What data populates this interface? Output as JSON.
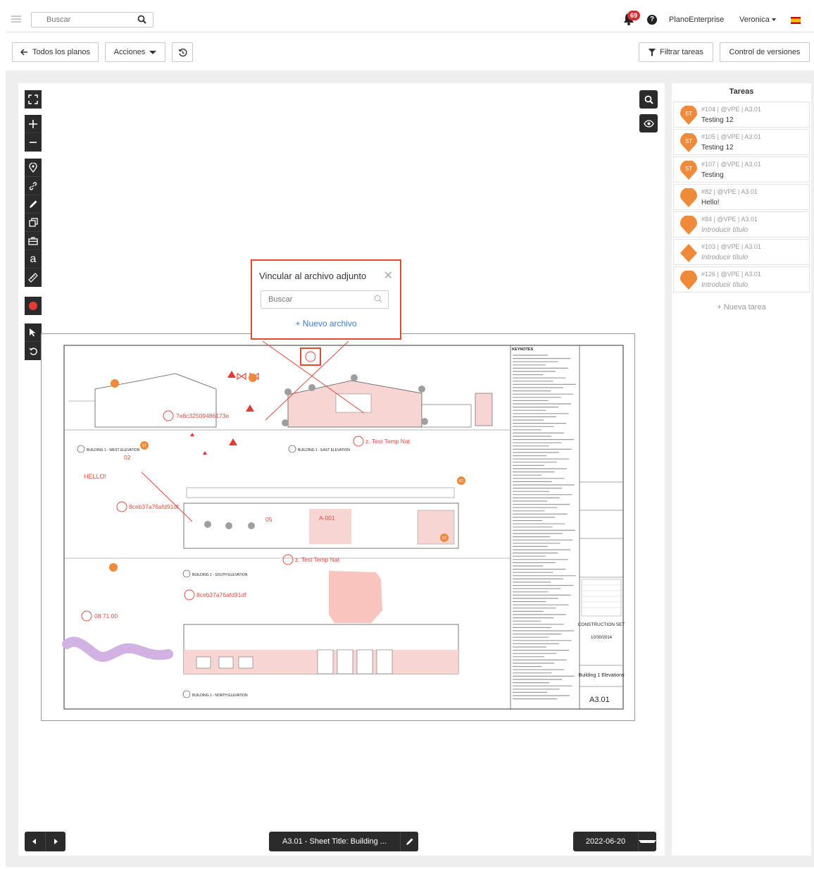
{
  "topbar": {
    "search_placeholder": "Buscar",
    "notification_count": "69",
    "company": "PlanoEnterprise",
    "user": "Veronica"
  },
  "toolbar": {
    "all_plans": "Todos los planos",
    "actions": "Acciones",
    "filter_tasks": "Filtrar tareas",
    "version_control": "Control de versiones"
  },
  "popup": {
    "title": "Vincular al archivo adjunto",
    "search_placeholder": "Buscar",
    "new_file": "+ Nuevo archivo"
  },
  "drawing": {
    "annotations": [
      "7e8c32509486173e",
      "z. Test Temp Nat",
      "HELLO!",
      "8ceb37a76afd91df",
      "02",
      "05",
      "A-001",
      "z. Test Temp Nat",
      "8ceb37a76afd91df",
      "08 71 00"
    ],
    "pin_label": "ST",
    "elevation_titles": [
      "BUILDING 1 - WEST ELEVATION",
      "BUILDING 1 - EAST ELEVATION",
      "BUILDING 1 - SOUTH ELEVATION",
      "BUILDING 1 - NORTH ELEVATION"
    ],
    "keynotes_title": "KEYNOTES",
    "title_block": {
      "status": "CONSTRUCTION SET",
      "date": "10/30/2014",
      "sheet_name": "Building 1 Elevations",
      "sheet_number": "A3.01"
    }
  },
  "bottom": {
    "sheet_label": "A3.01 - Sheet Title: Building ...",
    "date": "2022-06-20"
  },
  "sidebar": {
    "title": "Tareas",
    "tasks": [
      {
        "meta": "#104 | @VPE | A3.01",
        "title": "Testing 12",
        "badge": "ST",
        "shape": "pin",
        "placeholder": false
      },
      {
        "meta": "#105 | @VPE | A3.01",
        "title": "Testing 12",
        "badge": "ST",
        "shape": "pin",
        "placeholder": false
      },
      {
        "meta": "#107 | @VPE | A3.01",
        "title": "Testing",
        "badge": "ST",
        "shape": "pin",
        "placeholder": false
      },
      {
        "meta": "#82 | @VPE | A3.01",
        "title": "Hello!",
        "badge": "",
        "shape": "pin",
        "placeholder": false
      },
      {
        "meta": "#84 | @VPE | A3.01",
        "title": "Introducir título",
        "badge": "",
        "shape": "pin",
        "placeholder": true
      },
      {
        "meta": "#103 | @VPE | A3.01",
        "title": "Introducir título",
        "badge": "",
        "shape": "diamond",
        "placeholder": true
      },
      {
        "meta": "#126 | @VPE | A3.01",
        "title": "Introducir título",
        "badge": "",
        "shape": "pin",
        "placeholder": true
      }
    ],
    "new_task": "+ Nueva tarea"
  },
  "colors": {
    "pin": "#ef8a3b",
    "markup_red": "#e04c3f",
    "popup_border": "#e14a2b",
    "link_blue": "#3a7bd5",
    "badge_red": "#d0302f",
    "dark_control": "#2b2b2b"
  }
}
